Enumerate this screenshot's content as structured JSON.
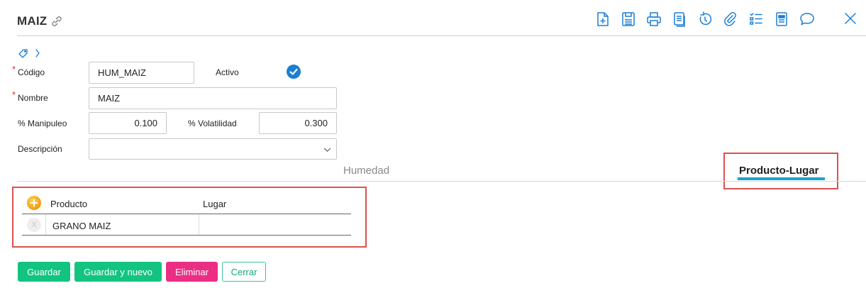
{
  "header": {
    "title": "MAIZ",
    "toolbar": [
      {
        "name": "new-document-icon",
        "label": "Nuevo"
      },
      {
        "name": "save-icon",
        "label": "Guardar"
      },
      {
        "name": "print-icon",
        "label": "Imprimir"
      },
      {
        "name": "copy-icon",
        "label": "Copiar"
      },
      {
        "name": "history-icon",
        "label": "Historial"
      },
      {
        "name": "attachment-icon",
        "label": "Adjuntos"
      },
      {
        "name": "checklist-icon",
        "label": "Lista"
      },
      {
        "name": "report-icon",
        "label": "Reporte"
      },
      {
        "name": "chat-icon",
        "label": "Comentarios"
      },
      {
        "name": "close-icon",
        "label": "Cerrar"
      }
    ]
  },
  "form": {
    "codigo_label": "Código",
    "codigo_value": "HUM_MAIZ",
    "activo_label": "Activo",
    "activo_checked": true,
    "nombre_label": "Nombre",
    "nombre_value": "MAIZ",
    "manipuleo_label": "% Manipuleo",
    "manipuleo_value": "0.100",
    "volatilidad_label": "% Volatilidad",
    "volatilidad_value": "0.300",
    "descripcion_label": "Descripción",
    "descripcion_value": ""
  },
  "tabs": [
    {
      "label": "Humedad",
      "active": false
    },
    {
      "label": "Producto-Lugar",
      "active": true
    }
  ],
  "grid": {
    "columns": [
      "Producto",
      "Lugar"
    ],
    "rows": [
      {
        "producto": "GRANO MAIZ",
        "lugar": ""
      }
    ],
    "delete_glyph": "X"
  },
  "actions": {
    "guardar": "Guardar",
    "guardar_nuevo": "Guardar y nuevo",
    "eliminar": "Eliminar",
    "cerrar": "Cerrar"
  },
  "colors": {
    "accent_green": "#12c480",
    "delete_pink": "#ec2d84",
    "tab_underline": "#1aa3cc",
    "icon_blue": "#1a7fd6",
    "highlight_red": "#d9534f"
  }
}
